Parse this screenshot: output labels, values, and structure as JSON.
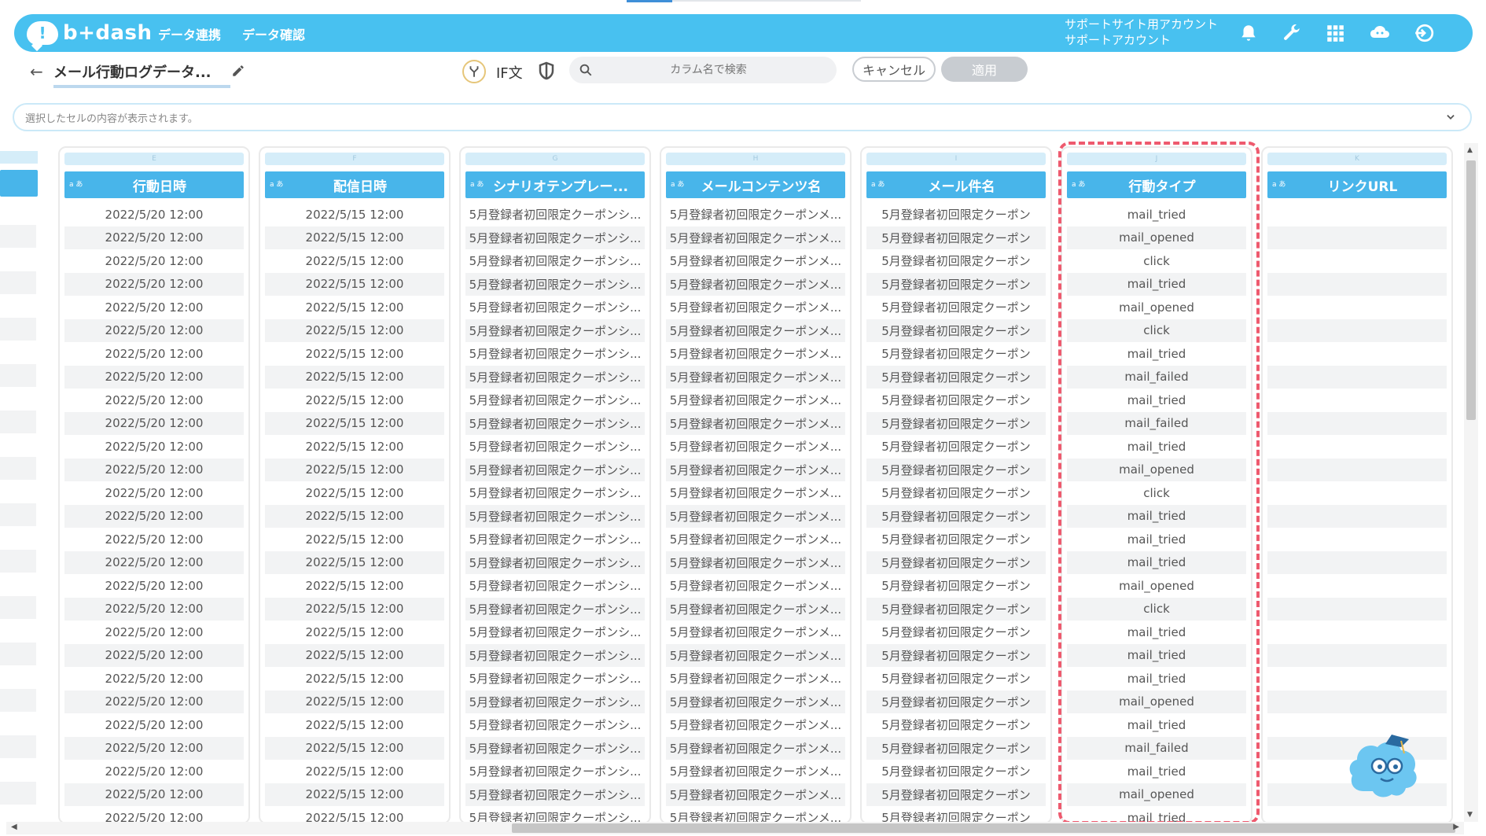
{
  "app": {
    "logo_text": "b+dash"
  },
  "nav": {
    "items": [
      "データ連携",
      "データ確認"
    ]
  },
  "account": {
    "line1": "サポートサイト用アカウント",
    "line2": "サポートアカウント"
  },
  "toolbar": {
    "title": "メール行動ログデータ...",
    "if_label": "IF文",
    "search_placeholder": "カラム名で検索",
    "cancel_label": "キャンセル",
    "apply_label": "適用"
  },
  "cell_bar": {
    "placeholder": "選択したセルの内容が表示されます。"
  },
  "columns": [
    {
      "letter": "E",
      "type": "a あ",
      "label": "行動日時"
    },
    {
      "letter": "F",
      "type": "a あ",
      "label": "配信日時"
    },
    {
      "letter": "G",
      "type": "a あ",
      "label": "シナリオテンプレー..."
    },
    {
      "letter": "H",
      "type": "a あ",
      "label": "メールコンテンツ名"
    },
    {
      "letter": "I",
      "type": "a あ",
      "label": "メール件名"
    },
    {
      "letter": "J",
      "type": "a あ",
      "label": "行動タイプ"
    },
    {
      "letter": "K",
      "type": "a あ",
      "label": "リンクURL"
    }
  ],
  "cells": {
    "action_datetime": "2022/5/20 12:00",
    "delivery_datetime": "2022/5/15 12:00",
    "scenario_template": "5月登録者初回限定クーポンシ...",
    "mail_content": "5月登録者初回限定クーポンメ...",
    "mail_subject": "5月登録者初回限定クーポン"
  },
  "action_types": [
    "mail_tried",
    "mail_opened",
    "click",
    "mail_tried",
    "mail_opened",
    "click",
    "mail_tried",
    "mail_failed",
    "mail_tried",
    "mail_failed",
    "mail_tried",
    "mail_opened",
    "click",
    "mail_tried",
    "mail_tried",
    "mail_tried",
    "mail_opened",
    "click",
    "mail_tried",
    "mail_tried",
    "mail_tried",
    "mail_opened",
    "mail_tried",
    "mail_failed",
    "mail_tried",
    "mail_opened",
    "mail_tried"
  ],
  "colors": {
    "header": "#48c1f0",
    "column_header": "#48b5ea",
    "highlight": "#ee5a6e"
  }
}
